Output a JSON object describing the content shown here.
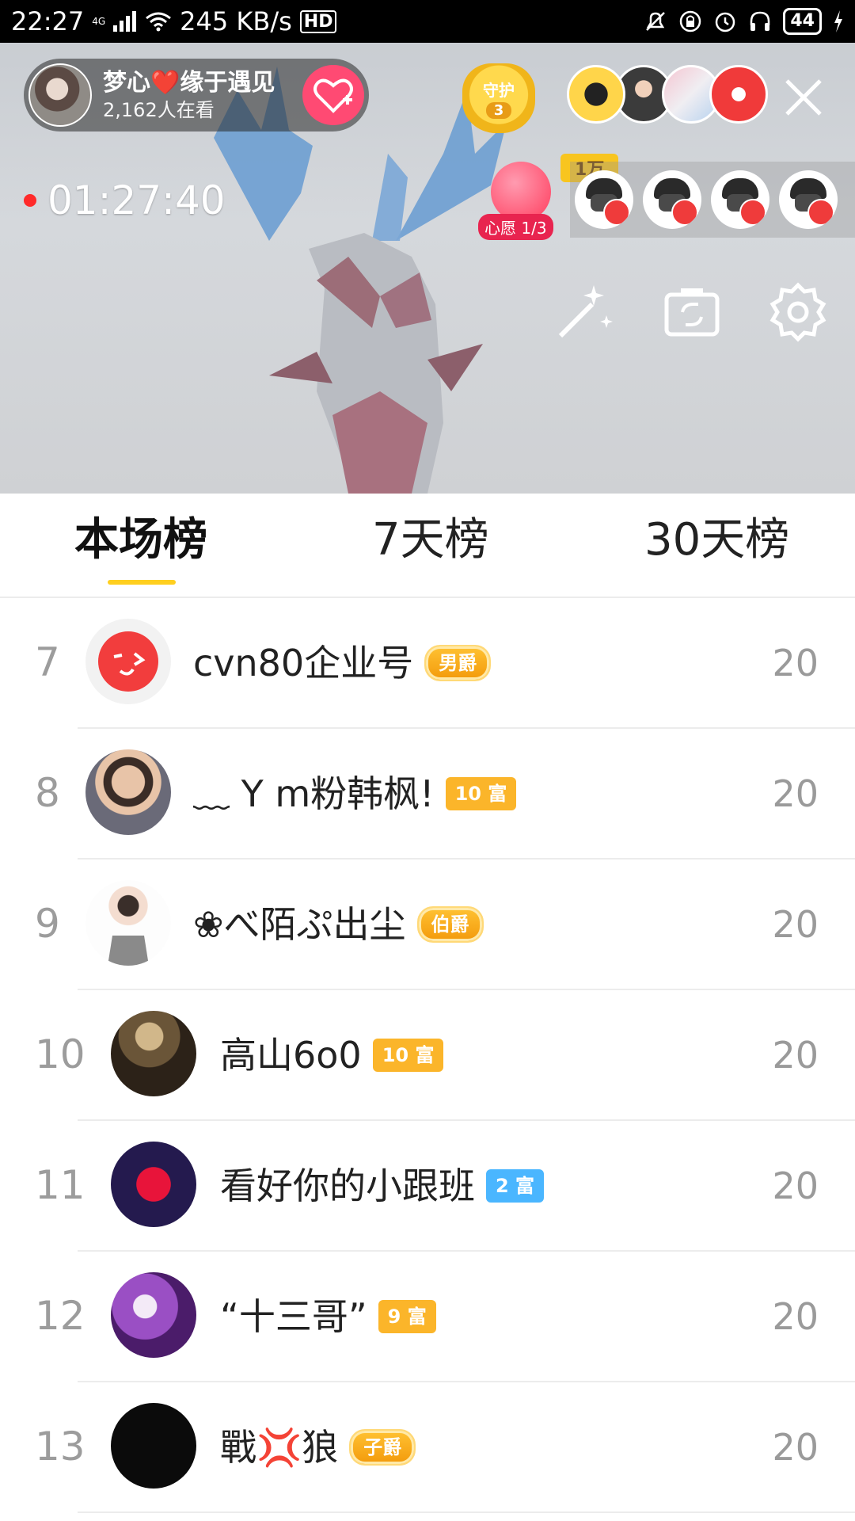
{
  "status_bar": {
    "time": "22:27",
    "network": "4G",
    "speed": "245 KB/s",
    "hd": "HD",
    "battery": "44"
  },
  "live": {
    "host_name": "梦心❤️缘于遇见",
    "viewers": "2,162人在看",
    "guard_label": "守护",
    "guard_count": "3",
    "top_viewer_count": "1万",
    "timer": "01:27:40",
    "wish_label": "心愿 1/3",
    "icons": [
      "magic-wand-icon",
      "camera-flip-icon",
      "settings-gear-icon",
      "close-icon",
      "follow-heart-icon"
    ]
  },
  "tabs": [
    {
      "label": "本场榜",
      "active": true
    },
    {
      "label": "7天榜",
      "active": false
    },
    {
      "label": "30天榜",
      "active": false
    }
  ],
  "ranking": [
    {
      "rank": "7",
      "name": "cvn80企业号",
      "badge": "男爵",
      "badge_type": "title",
      "score": "20"
    },
    {
      "rank": "8",
      "name": "﹏ Y m粉韩枫!",
      "badge": "10 富",
      "badge_type": "gold",
      "score": "20"
    },
    {
      "rank": "9",
      "name": "❀べ陌ぷ出尘",
      "badge": "伯爵",
      "badge_type": "title",
      "score": "20"
    },
    {
      "rank": "10",
      "name": "高山6o0",
      "badge": "10 富",
      "badge_type": "gold",
      "score": "20"
    },
    {
      "rank": "11",
      "name": "看好你的小跟班",
      "badge": "2 富",
      "badge_type": "blue",
      "score": "20"
    },
    {
      "rank": "12",
      "name": "“十三哥”",
      "badge": "9 富",
      "badge_type": "gold",
      "score": "20"
    },
    {
      "rank": "13",
      "name": "戰💢狼",
      "badge": "子爵",
      "badge_type": "title",
      "score": "20"
    }
  ],
  "colors": {
    "accent": "#ffcf1f",
    "follow": "#ff4a73",
    "rank_gray": "#9c9c9c"
  }
}
